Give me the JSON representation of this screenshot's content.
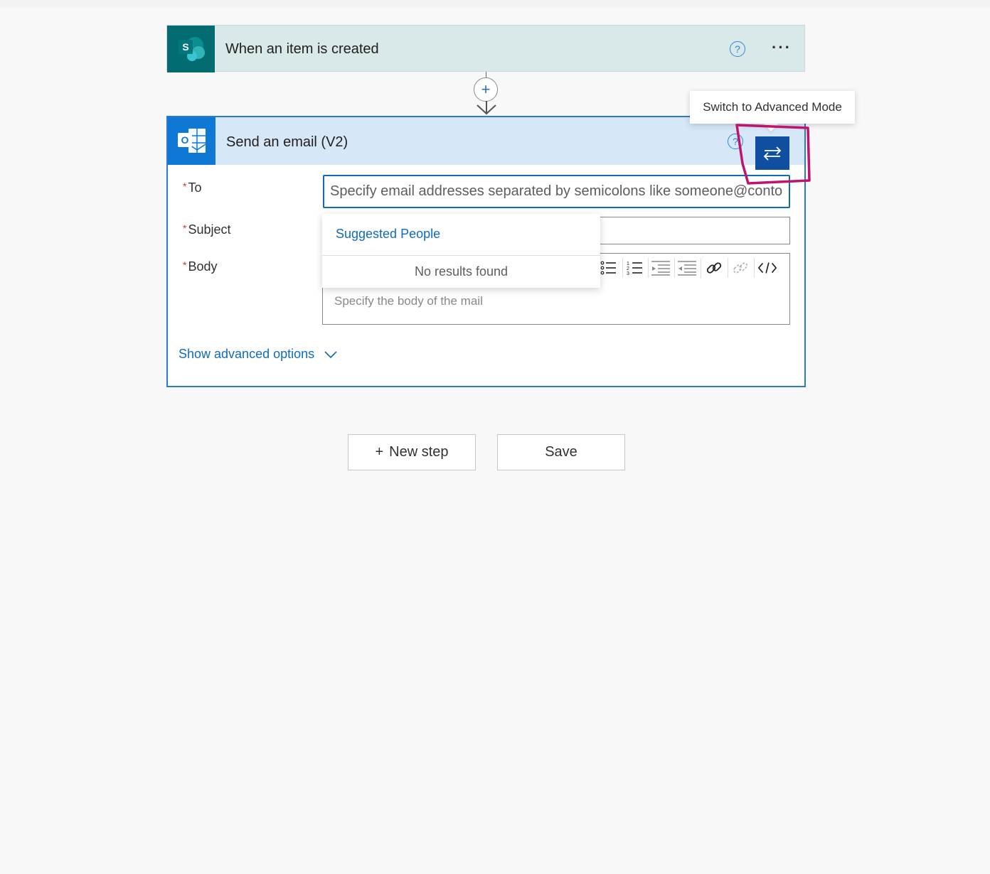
{
  "trigger": {
    "title": "When an item is created",
    "icon": "sharepoint-icon",
    "help_glyph": "?",
    "more_glyph": "···"
  },
  "connector": {
    "add_glyph": "+"
  },
  "action": {
    "title": "Send an email (V2)",
    "icon": "outlook-icon",
    "help_glyph": "?",
    "fields": {
      "to": {
        "label": "To",
        "placeholder": "Specify email addresses separated by semicolons like someone@contoso.com"
      },
      "subject": {
        "label": "Subject"
      },
      "body": {
        "label": "Body",
        "placeholder": "Specify the body of the mail"
      }
    },
    "required_marker": "*",
    "advanced_link": "Show advanced options"
  },
  "suggestions": {
    "header": "Suggested People",
    "empty": "No results found"
  },
  "tooltip": {
    "text": "Switch to Advanced Mode"
  },
  "buttons": {
    "new_step": "New step",
    "new_step_plus": "+",
    "save": "Save"
  },
  "colors": {
    "accent": "#0f6cbd",
    "sharepoint": "#036c70",
    "outlook": "#0f78d4",
    "advanced_button": "#0f4ea0",
    "highlight": "#c0136b"
  }
}
